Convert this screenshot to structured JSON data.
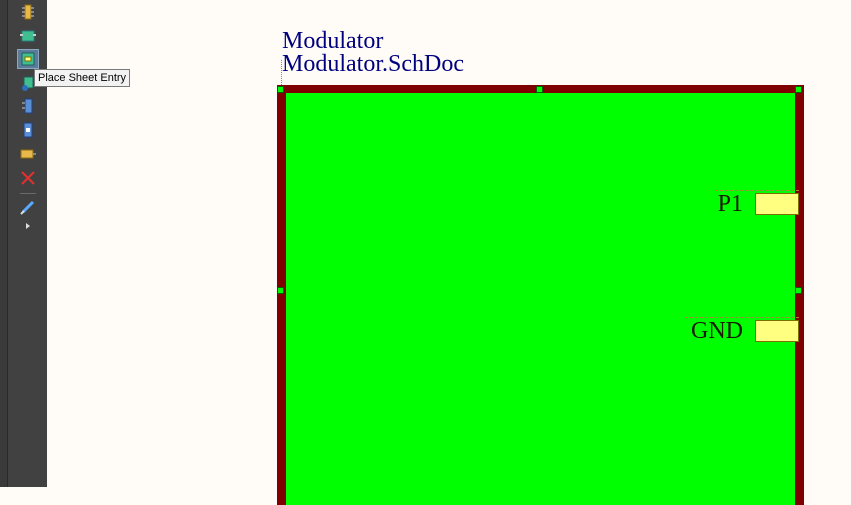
{
  "toolbar": {
    "items": [
      {
        "icon": "component-icon"
      },
      {
        "icon": "sheet-symbol-icon"
      },
      {
        "icon": "sheet-entry-icon",
        "active": true
      },
      {
        "icon": "device-sheet-icon"
      },
      {
        "icon": "harness-connector-icon"
      },
      {
        "icon": "harness-entry-icon"
      },
      {
        "icon": "directive-icon"
      },
      {
        "icon": "no-erc-icon"
      },
      {
        "icon": "line-icon"
      },
      {
        "icon": "more-arrow-icon"
      }
    ],
    "tooltip": "Place Sheet Entry"
  },
  "sheet": {
    "designator": "Modulator",
    "filename": "Modulator.SchDoc",
    "colors": {
      "border": "#7f0000",
      "fill": "#00ff00",
      "text": "#00007f"
    },
    "entries": [
      {
        "name": "P1",
        "fill": "#ffff80"
      },
      {
        "name": "GND",
        "fill": "#ffff80"
      }
    ]
  }
}
